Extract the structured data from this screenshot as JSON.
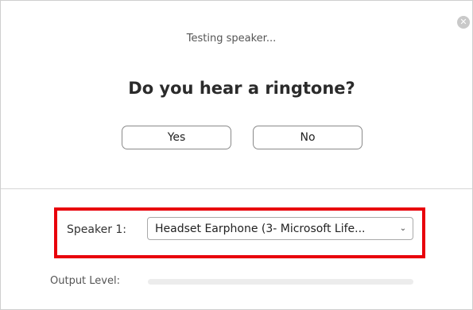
{
  "status": "Testing speaker...",
  "prompt": "Do you hear a ringtone?",
  "buttons": {
    "yes": "Yes",
    "no": "No"
  },
  "close_icon": "close-icon",
  "speaker": {
    "label": "Speaker 1:",
    "selected": "Headset Earphone (3- Microsoft Life...",
    "chevron_icon": "chevron-down-icon"
  },
  "output": {
    "label": "Output Level:",
    "level": 0
  },
  "colors": {
    "highlight": "#e8000b",
    "meter_track": "#ececec"
  }
}
